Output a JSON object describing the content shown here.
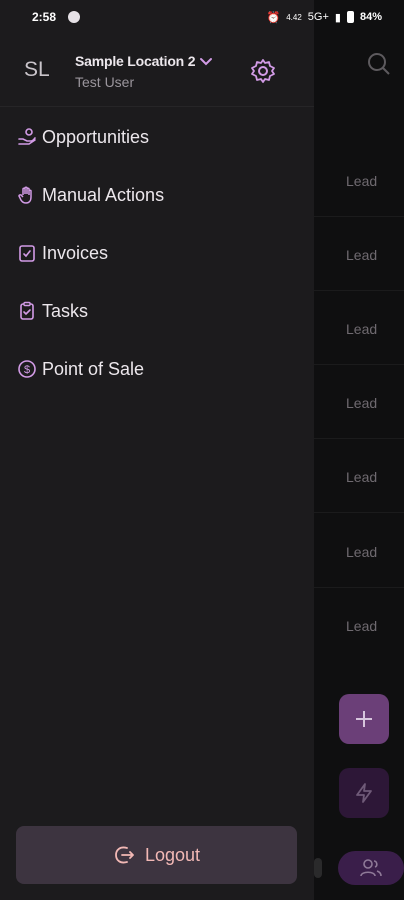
{
  "status_bar": {
    "time": "2:58",
    "data_speed": "4.42",
    "network": "5G+",
    "battery": "84%"
  },
  "drawer": {
    "avatar_initials": "SL",
    "location_name": "Sample Location 2",
    "user_name": "Test User",
    "menu": [
      {
        "label": "Opportunities",
        "icon": "hand-coins-icon"
      },
      {
        "label": "Manual Actions",
        "icon": "hand-icon"
      },
      {
        "label": "Invoices",
        "icon": "invoice-icon"
      },
      {
        "label": "Tasks",
        "icon": "clipboard-check-icon"
      },
      {
        "label": "Point of Sale",
        "icon": "dollar-circle-icon"
      }
    ],
    "logout_label": "Logout"
  },
  "background": {
    "lead_labels": [
      "Lead",
      "Lead",
      "Lead",
      "Lead",
      "Lead",
      "Lead",
      "Lead"
    ]
  },
  "colors": {
    "accent": "#d29be6",
    "drawer_bg": "#1c1b1d",
    "logout_text": "#f2b8b5"
  }
}
